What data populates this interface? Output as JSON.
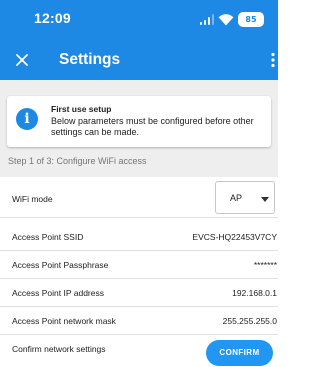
{
  "status_bar": {
    "time": "12:09",
    "battery": "85"
  },
  "app_bar": {
    "title": "Settings",
    "close_icon": "close-icon",
    "menu_icon": "more-vert-icon"
  },
  "info_card": {
    "icon": "info-icon",
    "title": "First use setup",
    "body": "Below parameters must be configured before other settings can be made."
  },
  "step_label": "Step 1 of 3: Configure WiFi access",
  "wifi_mode": {
    "label": "WiFi mode",
    "selected": "AP"
  },
  "fields": {
    "ssid": {
      "label": "Access Point SSID",
      "value": "EVCS-HQ22453V7CY"
    },
    "passphrase": {
      "label": "Access Point Passphrase",
      "value": "*******"
    },
    "ip": {
      "label": "Access Point IP address",
      "value": "192.168.0.1"
    },
    "mask": {
      "label": "Access Point network mask",
      "value": "255.255.255.0"
    }
  },
  "confirm": {
    "label": "Confirm network settings",
    "button": "CONFIRM"
  },
  "colors": {
    "primary": "#1e88e5",
    "button": "#2196f3",
    "background": "#eeeeee"
  }
}
